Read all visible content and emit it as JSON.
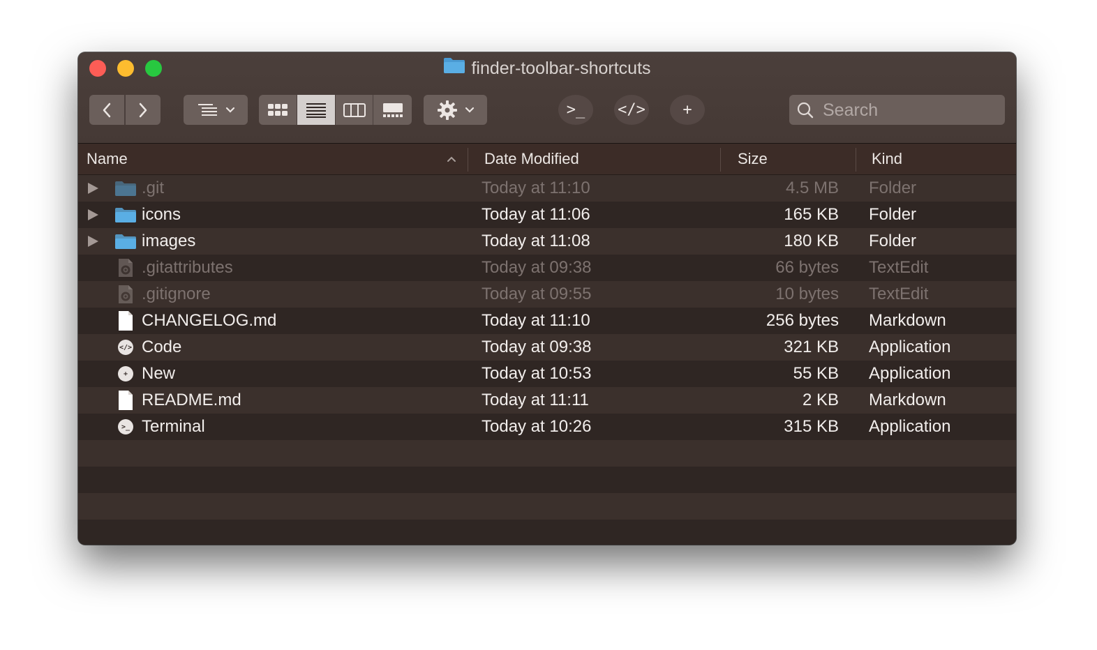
{
  "window": {
    "title": "finder-toolbar-shortcuts"
  },
  "toolbar": {
    "search_placeholder": "Search",
    "shortcuts": [
      {
        "name": "terminal",
        "glyph": ">_"
      },
      {
        "name": "code",
        "glyph": "</>"
      },
      {
        "name": "new",
        "glyph": "+"
      }
    ],
    "view_modes": [
      "icon",
      "list",
      "column",
      "gallery"
    ],
    "active_view": "list"
  },
  "columns": {
    "name": "Name",
    "date": "Date Modified",
    "size": "Size",
    "kind": "Kind",
    "sort_column": "Name",
    "sort_direction": "ascending"
  },
  "files": [
    {
      "name": ".git",
      "date": "Today at 11:10",
      "size": "4.5 MB",
      "kind": "Folder",
      "icon": "folder-icon",
      "expandable": true,
      "dim": true
    },
    {
      "name": "icons",
      "date": "Today at 11:06",
      "size": "165 KB",
      "kind": "Folder",
      "icon": "folder-icon",
      "expandable": true,
      "dim": false
    },
    {
      "name": "images",
      "date": "Today at 11:08",
      "size": "180 KB",
      "kind": "Folder",
      "icon": "folder-icon",
      "expandable": true,
      "dim": false
    },
    {
      "name": ".gitattributes",
      "date": "Today at 09:38",
      "size": "66 bytes",
      "kind": "TextEdit",
      "icon": "config-file-icon",
      "expandable": false,
      "dim": true
    },
    {
      "name": ".gitignore",
      "date": "Today at 09:55",
      "size": "10 bytes",
      "kind": "TextEdit",
      "icon": "config-file-icon",
      "expandable": false,
      "dim": true
    },
    {
      "name": "CHANGELOG.md",
      "date": "Today at 11:10",
      "size": "256 bytes",
      "kind": "Markdown",
      "icon": "document-icon",
      "expandable": false,
      "dim": false
    },
    {
      "name": "Code",
      "date": "Today at 09:38",
      "size": "321 KB",
      "kind": "Application",
      "icon": "code-app-icon",
      "glyph": "</>",
      "expandable": false,
      "dim": false
    },
    {
      "name": "New",
      "date": "Today at 10:53",
      "size": "55 KB",
      "kind": "Application",
      "icon": "new-app-icon",
      "glyph": "+",
      "expandable": false,
      "dim": false
    },
    {
      "name": "README.md",
      "date": "Today at 11:11",
      "size": "2 KB",
      "kind": "Markdown",
      "icon": "document-icon",
      "expandable": false,
      "dim": false
    },
    {
      "name": "Terminal",
      "date": "Today at 10:26",
      "size": "315 KB",
      "kind": "Application",
      "icon": "terminal-app-icon",
      "glyph": ">_",
      "expandable": false,
      "dim": false
    }
  ],
  "colors": {
    "folder": "#5aaee4",
    "traffic_close": "#fd5d56",
    "traffic_minimize": "#fdbc2f",
    "traffic_zoom": "#28c840"
  }
}
